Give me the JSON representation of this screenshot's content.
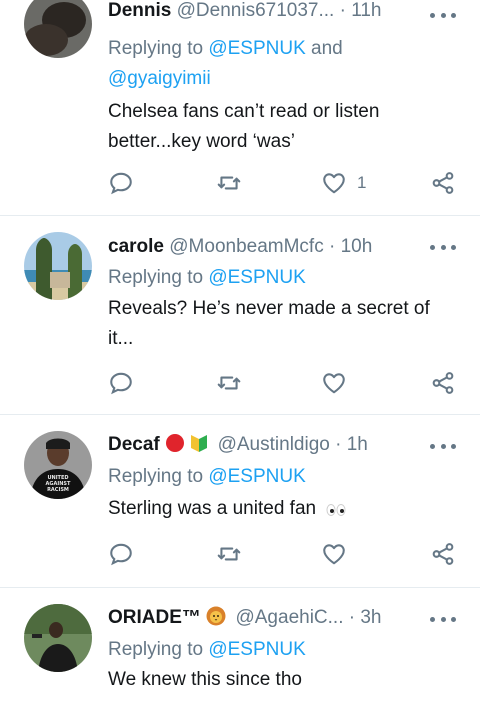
{
  "tweets": [
    {
      "name": "Dennis",
      "handle_meta": "@Dennis671037... · 11h",
      "replying_prefix": "Replying to",
      "reply_to_1": "@ESPNUK",
      "reply_and": "and",
      "reply_to_2": "@gyaigyimii",
      "body": "Chelsea fans can’t read or listen better...key word ‘was’",
      "like_count": "1"
    },
    {
      "name": "carole",
      "handle_meta": "@MoonbeamMcfc · 10h",
      "replying_prefix": "Replying to",
      "reply_to_1": "@ESPNUK",
      "body": "Reveals? He’s never made a secret of it...",
      "like_count": ""
    },
    {
      "name": "Decaf",
      "handle_meta": "@Austinldigo · 1h",
      "replying_prefix": "Replying to",
      "reply_to_1": "@ESPNUK",
      "body": "Sterling was a united fan",
      "avatar_shirt_text": "UNITED AGAINST RACISM",
      "like_count": ""
    },
    {
      "name": "ORIADE™",
      "handle_meta": "@AgaehiC... · 3h",
      "replying_prefix": "Replying to",
      "reply_to_1": "@ESPNUK",
      "body": "We knew this since tho",
      "like_count": ""
    }
  ],
  "colors": {
    "link": "#1da1f2",
    "meta": "#657786",
    "divider": "#e6ecf0"
  },
  "icons": [
    "reply-icon",
    "retweet-icon",
    "like-icon",
    "share-icon",
    "more-icon",
    "red-circle-emoji",
    "beginner-badge-emoji",
    "eyes-emoji",
    "lion-emoji"
  ]
}
